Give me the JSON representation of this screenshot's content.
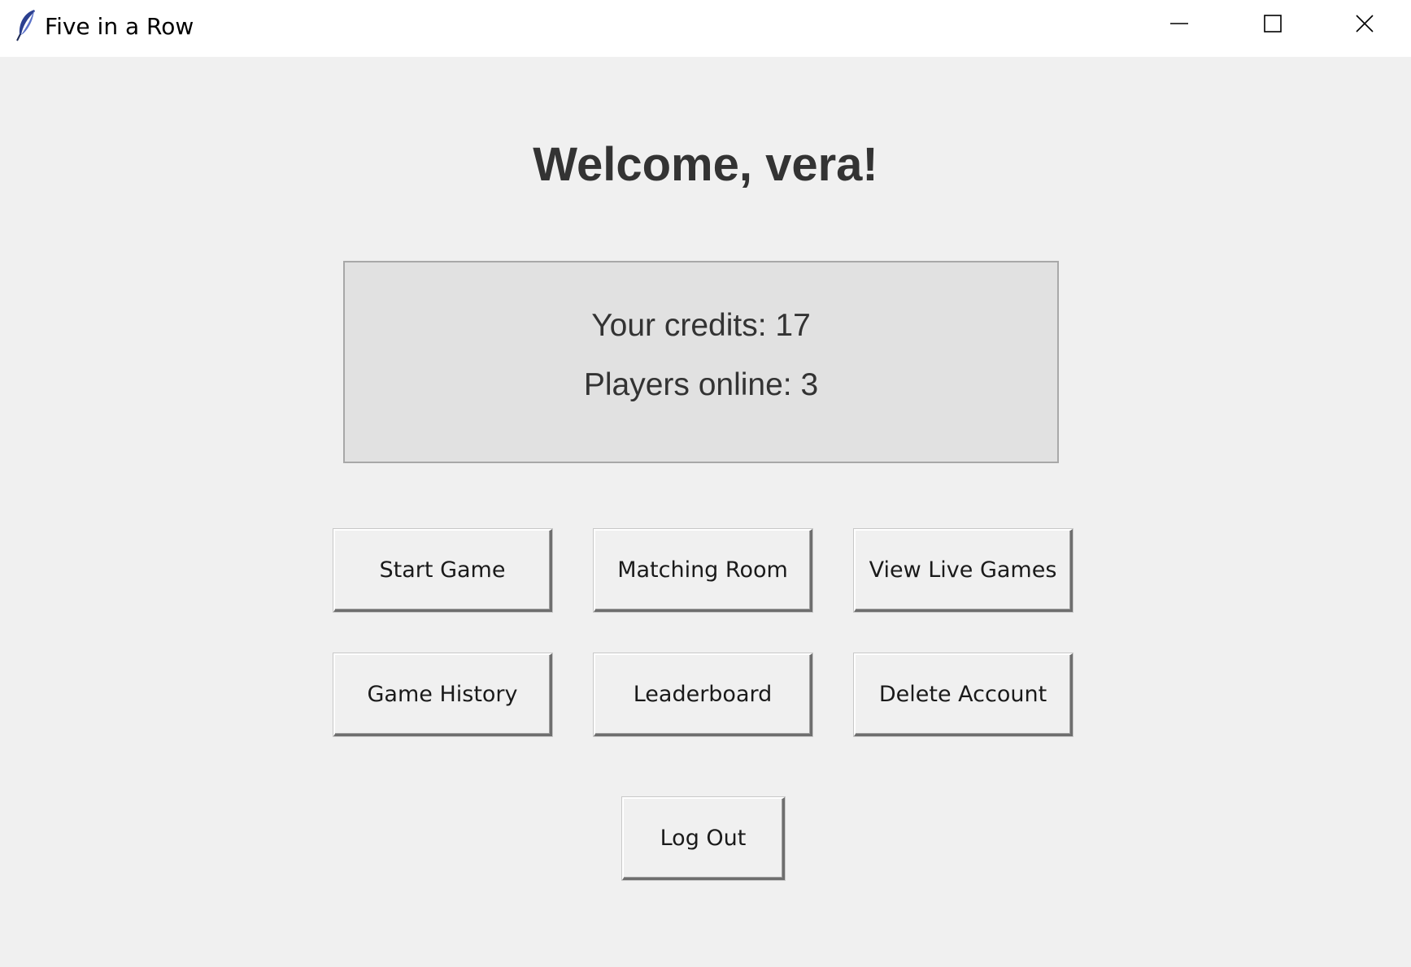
{
  "window": {
    "title": "Five in a Row",
    "icon": "feather-icon",
    "controls": [
      "minimize-icon",
      "maximize-icon",
      "close-icon"
    ]
  },
  "main": {
    "welcome": "Welcome, vera!",
    "info": {
      "credits": "Your credits: 17",
      "online": "Players online: 3"
    },
    "buttons": {
      "start_game": "Start Game",
      "matching_room": "Matching Room",
      "view_live_games": "View Live Games",
      "game_history": "Game History",
      "leaderboard": "Leaderboard",
      "delete_account": "Delete Account",
      "log_out": "Log Out"
    }
  },
  "colors": {
    "background": "#f0f0f0",
    "titlebar": "#ffffff",
    "panel": "#e1e1e1",
    "text": "#333333"
  }
}
